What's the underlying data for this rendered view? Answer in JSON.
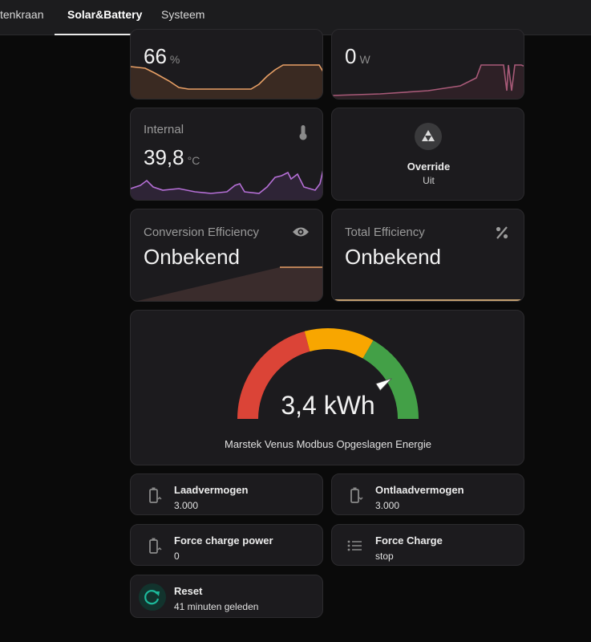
{
  "tabs": [
    {
      "label": "tenkraan"
    },
    {
      "label": "Solar&Battery"
    },
    {
      "label": "Systeem"
    }
  ],
  "cards": {
    "soc": {
      "value": "66",
      "unit": "%"
    },
    "power": {
      "value": "0",
      "unit": "W"
    },
    "internal": {
      "label": "Internal",
      "value": "39,8",
      "unit": "°C"
    },
    "override": {
      "label": "Override",
      "state": "Uit"
    },
    "conversion": {
      "label": "Conversion Efficiency",
      "value": "Onbekend"
    },
    "total": {
      "label": "Total Efficiency",
      "value": "Onbekend"
    }
  },
  "gauge": {
    "value": "3,4 kWh",
    "label": "Marstek Venus Modbus Opgeslagen Energie",
    "level_fraction": 0.82
  },
  "tiles": {
    "laadvermogen": {
      "title": "Laadvermogen",
      "value": "3.000"
    },
    "ontlaadvermogen": {
      "title": "Ontlaadvermogen",
      "value": "3.000"
    },
    "force_charge_power": {
      "title": "Force charge power",
      "value": "0"
    },
    "force_charge": {
      "title": "Force Charge",
      "value": "stop"
    },
    "reset": {
      "title": "Reset",
      "value": "41 minuten geleden"
    }
  },
  "colors": {
    "accent_orange": "#e8a066",
    "accent_pink": "#a85a78",
    "accent_purple": "#b56fd6",
    "gauge_red": "#db4437",
    "gauge_yellow": "#f8a600",
    "gauge_green": "#43a047",
    "reset_teal": "#1db99b"
  }
}
